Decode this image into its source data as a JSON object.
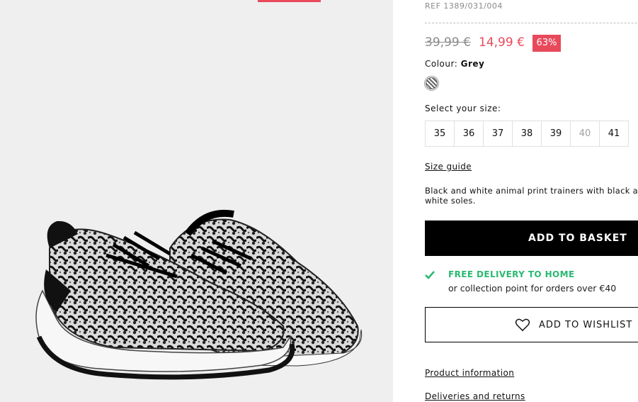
{
  "product": {
    "ref": "REF 1389/031/004",
    "old_price": "39,99 €",
    "new_price": "14,99 €",
    "discount": "63%",
    "colour_label": "Colour:",
    "colour_value": "Grey",
    "size_label": "Select your size:",
    "sizes": [
      {
        "label": "35",
        "available": true
      },
      {
        "label": "36",
        "available": true
      },
      {
        "label": "37",
        "available": true
      },
      {
        "label": "38",
        "available": true
      },
      {
        "label": "39",
        "available": true
      },
      {
        "label": "40",
        "available": false
      },
      {
        "label": "41",
        "available": true
      }
    ],
    "size_guide": "Size guide",
    "description": "Black and white animal print trainers with black and white soles."
  },
  "actions": {
    "add_to_basket": "ADD TO BASKET",
    "add_to_wishlist": "ADD TO WISHLIST"
  },
  "delivery": {
    "title": "FREE DELIVERY TO HOME",
    "subtitle": "or collection point for orders over €40"
  },
  "links": {
    "product_information": "Product information",
    "deliveries_returns": "Deliveries and returns"
  },
  "colors": {
    "accent": "#e8495b",
    "success": "#2ab873"
  },
  "icons": {
    "check": "check-icon",
    "heart": "heart-icon",
    "swatch": "colour-swatch"
  }
}
